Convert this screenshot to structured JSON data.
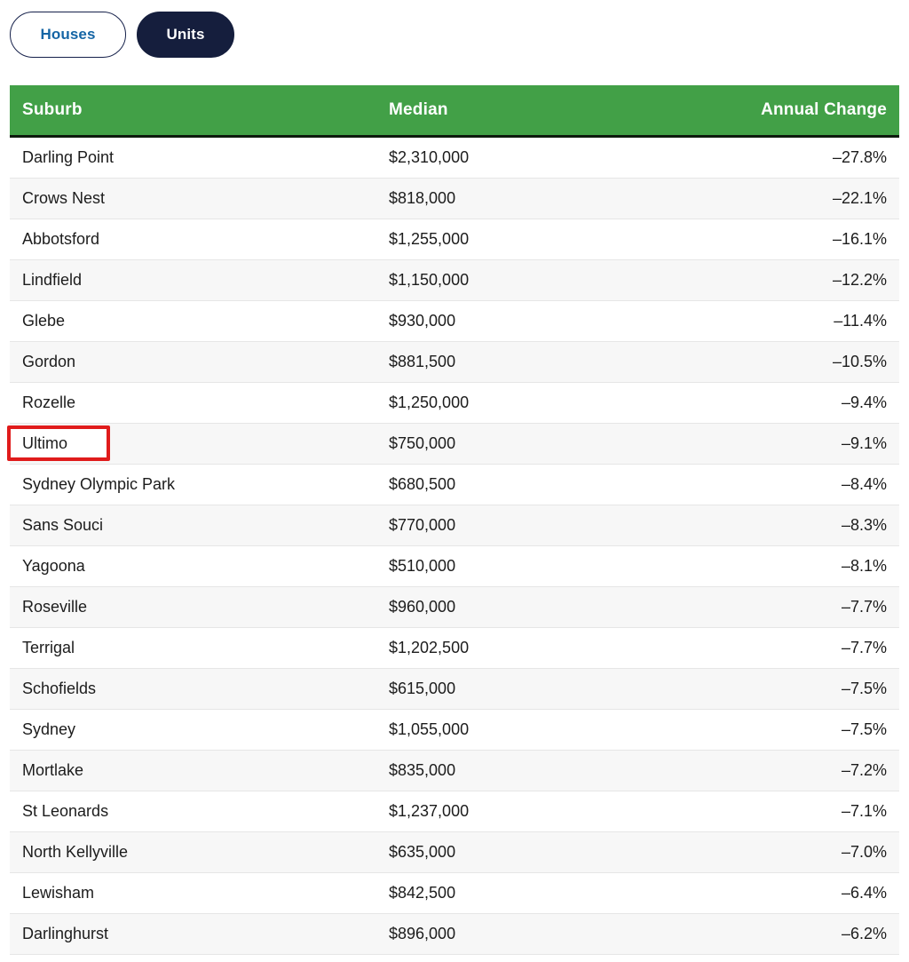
{
  "tabs": [
    {
      "label": "Houses",
      "active": false
    },
    {
      "label": "Units",
      "active": true
    }
  ],
  "colors": {
    "header_green": "#42a047",
    "tab_active_bg": "#151e3d",
    "tab_inactive_text": "#1565a5",
    "highlight_red": "#e01b1b",
    "row_alt_bg": "#f7f7f7"
  },
  "table": {
    "columns": [
      {
        "key": "suburb",
        "label": "Suburb",
        "align": "left"
      },
      {
        "key": "median",
        "label": "Median",
        "align": "left"
      },
      {
        "key": "change",
        "label": "Annual Change",
        "align": "right"
      }
    ],
    "highlighted_row_index": 7,
    "rows": [
      {
        "suburb": "Darling Point",
        "median": "$2,310,000",
        "change": "–27.8%"
      },
      {
        "suburb": "Crows Nest",
        "median": "$818,000",
        "change": "–22.1%"
      },
      {
        "suburb": "Abbotsford",
        "median": "$1,255,000",
        "change": "–16.1%"
      },
      {
        "suburb": "Lindfield",
        "median": "$1,150,000",
        "change": "–12.2%"
      },
      {
        "suburb": "Glebe",
        "median": "$930,000",
        "change": "–11.4%"
      },
      {
        "suburb": "Gordon",
        "median": "$881,500",
        "change": "–10.5%"
      },
      {
        "suburb": "Rozelle",
        "median": "$1,250,000",
        "change": "–9.4%"
      },
      {
        "suburb": "Ultimo",
        "median": "$750,000",
        "change": "–9.1%"
      },
      {
        "suburb": "Sydney Olympic Park",
        "median": "$680,500",
        "change": "–8.4%"
      },
      {
        "suburb": "Sans Souci",
        "median": "$770,000",
        "change": "–8.3%"
      },
      {
        "suburb": "Yagoona",
        "median": "$510,000",
        "change": "–8.1%"
      },
      {
        "suburb": "Roseville",
        "median": "$960,000",
        "change": "–7.7%"
      },
      {
        "suburb": "Terrigal",
        "median": "$1,202,500",
        "change": "–7.7%"
      },
      {
        "suburb": "Schofields",
        "median": "$615,000",
        "change": "–7.5%"
      },
      {
        "suburb": "Sydney",
        "median": "$1,055,000",
        "change": "–7.5%"
      },
      {
        "suburb": "Mortlake",
        "median": "$835,000",
        "change": "–7.2%"
      },
      {
        "suburb": "St Leonards",
        "median": "$1,237,000",
        "change": "–7.1%"
      },
      {
        "suburb": "North Kellyville",
        "median": "$635,000",
        "change": "–7.0%"
      },
      {
        "suburb": "Lewisham",
        "median": "$842,500",
        "change": "–6.4%"
      },
      {
        "suburb": "Darlinghurst",
        "median": "$896,000",
        "change": "–6.2%"
      }
    ]
  }
}
